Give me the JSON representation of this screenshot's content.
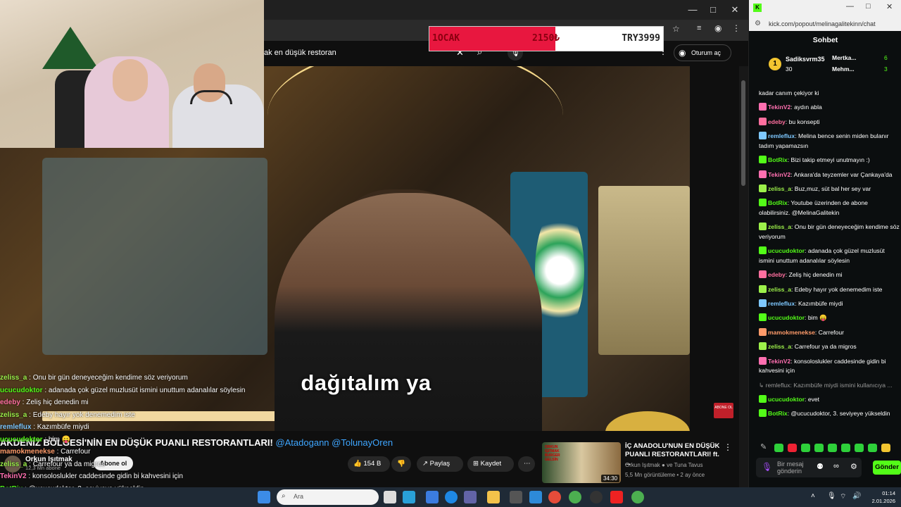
{
  "youtube": {
    "search_query": "ak en düşük restoran",
    "signin_label": "Oturum aç",
    "caption": "dağıtalım ya",
    "video_title": "AKDENİZ BÖLGESİ'NİN EN DÜŞÜK PUANLI RESTORANTLARI!",
    "video_title_tags": "@Atadogann @TolunayOren",
    "channel_name": "Orkun Işıtmak",
    "channel_subs": "12,3 Mn abone",
    "subscribe_label": "Abone ol",
    "like_count": "154 B",
    "share_label": "Paylaş",
    "save_label": "Kaydet",
    "subscribe_badge": "ABONE OL",
    "recommended": {
      "title": "İÇ ANADOLU'NUN EN DÜŞÜK PUANLI RESTORANTLARI! ft. ...",
      "channel": "Orkun Işıtmak ● ve Tuna Tavus",
      "meta": "5,5 Mn görüntüleme • 2 ay önce",
      "duration": "34:30",
      "thumb_text": "ORKUN IŞITMAK BURGER GELSİN"
    }
  },
  "ticker": {
    "month": "1OCAK",
    "current": "2150₺",
    "goal": "TRY3999",
    "fill_fraction": 0.54
  },
  "overlay_chat": [
    {
      "user": "zeliss_a",
      "text": " : Onu bir gün deneyeceğim kendime söz veriyorum",
      "color": "#9cf04a"
    },
    {
      "user": "ucucudoktor",
      "text": " : adanada çok güzel muzlusüt ismini unuttum adanalılar söylesin",
      "color": "#53fc18"
    },
    {
      "user": "edeby",
      "text": " : Zeliş hiç denedin mi",
      "color": "#ff6f9f"
    },
    {
      "user": "zeliss_a",
      "text": " : Edeby hayır yok denemedim iste",
      "color": "#9cf04a"
    },
    {
      "user": "remleflux",
      "text": " : Kazımbüfe miydi",
      "color": "#7ec8ff"
    },
    {
      "user": "ucucudoktor",
      "text": " : bim 😛",
      "color": "#53fc18"
    },
    {
      "user": "mamokmenekse",
      "text": " : Carrefour",
      "color": "#ff9b6a"
    },
    {
      "user": "zeliss_a",
      "text": " : Carrefour ya da migros",
      "color": "#9cf04a"
    },
    {
      "user": "TekinV2",
      "text": " : konsoloslukler caddesinde gidin bi kahvesini için",
      "color": "#ff6fb0"
    },
    {
      "user": "BotRix",
      "text": " : @ucucudoktor, 3. seviyeye yükseldin",
      "color": "#53fc18"
    }
  ],
  "kick": {
    "url": "kick.com/popout/melinagalitekinn/chat",
    "header": "Sohbet",
    "top_gifter": {
      "name": "Sadiksvrm35",
      "count": "30"
    },
    "gifter2": {
      "name": "Mertka...",
      "count": "6"
    },
    "gifter3": {
      "name": "Mehm...",
      "count": "3"
    },
    "messages": [
      {
        "user": "",
        "text": "kadar canım çekiyor ki",
        "color": "#fff"
      },
      {
        "user": "TekinV2",
        "text": ": aydın abla",
        "color": "#ff6fb0"
      },
      {
        "user": "edeby",
        "text": ": bu konsepti",
        "color": "#ff6f9f"
      },
      {
        "user": "remleflux",
        "text": ": Melina bence senin miden bulanır tadım yapamazsın",
        "color": "#7ec8ff"
      },
      {
        "user": "BotRix",
        "text": ": Bizi takip etmeyi unutmayın :)",
        "color": "#53fc18"
      },
      {
        "user": "TekinV2",
        "text": ": Ankara'da teyzemler var Çankaya'da",
        "color": "#ff6fb0"
      },
      {
        "user": "zeliss_a",
        "text": ": Buz,muz, süt bal her sey var",
        "color": "#9cf04a"
      },
      {
        "user": "BotRix",
        "text": ": Youtube üzerinden de abone olabilirsiniz. @MelinaGalitekin",
        "color": "#53fc18"
      },
      {
        "user": "zeliss_a",
        "text": ": Onu bir gün deneyeceğim kendime söz veriyorum",
        "color": "#9cf04a"
      },
      {
        "user": "ucucudoktor",
        "text": ": adanada çok güzel muzlusüt ismini unuttum adanalılar söylesin",
        "color": "#53fc18"
      },
      {
        "user": "edeby",
        "text": ": Zeliş hiç denedin mi",
        "color": "#ff6f9f"
      },
      {
        "user": "zeliss_a",
        "text": ": Edeby hayır yok denemedim iste",
        "color": "#9cf04a"
      },
      {
        "user": "remleflux",
        "text": ": Kazımbüfe miydi",
        "color": "#7ec8ff"
      },
      {
        "user": "ucucudoktor",
        "text": ": bim 😛",
        "color": "#53fc18"
      },
      {
        "user": "mamokmenekse",
        "text": ": Carrefour",
        "color": "#ff9b6a"
      },
      {
        "user": "zeliss_a",
        "text": ": Carrefour ya da migros",
        "color": "#9cf04a"
      },
      {
        "user": "TekinV2",
        "text": ": konsoloslukler caddesinde gidin bi kahvesini için",
        "color": "#ff6fb0"
      },
      {
        "user": "",
        "text": "↳ remleflux: Kazımbüfe miydi ismini kullanıcıya ...",
        "color": "#999"
      },
      {
        "user": "ucucudoktor",
        "text": ": evet",
        "color": "#53fc18"
      },
      {
        "user": "BotRix",
        "text": ": @ucucudoktor, 3. seviyeye yükseldin",
        "color": "#53fc18"
      }
    ],
    "input_placeholder": "Bir mesaj gönderin",
    "send_label": "Gönder"
  },
  "taskbar": {
    "search_placeholder": "Ara",
    "time": "01:14",
    "date": "2.01.2026"
  }
}
